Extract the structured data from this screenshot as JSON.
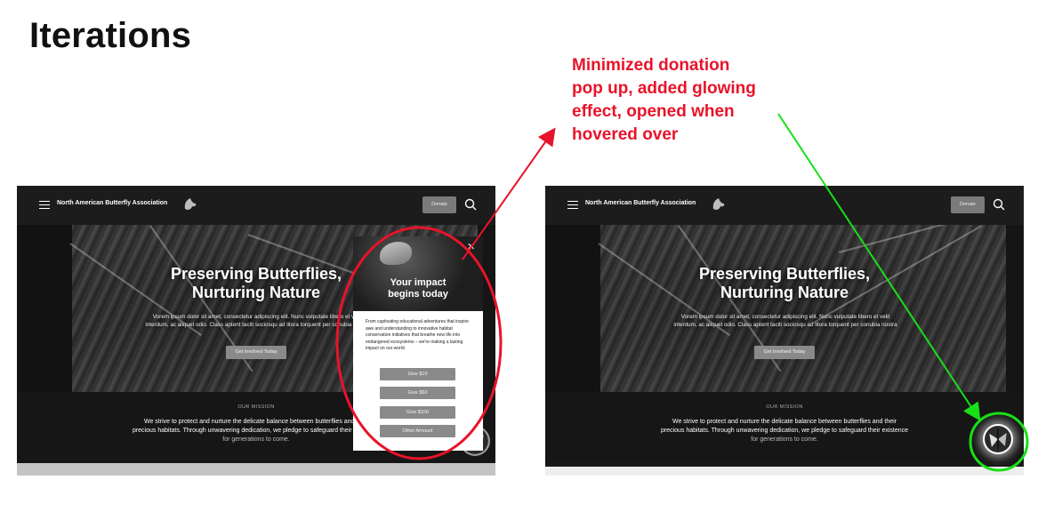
{
  "slide": {
    "title": "Iterations",
    "annotation": {
      "lines": [
        "Minimized donation",
        "pop up, added glowing",
        "effect, opened when",
        "hovered over"
      ],
      "color": "#e8132a"
    }
  },
  "site": {
    "brand": "North American Butterfly Association",
    "donate_label": "Donate",
    "hero": {
      "title_line1": "Preserving Butterflies,",
      "title_line2": "Nurturing Nature",
      "body_line1": "Vorem ipsum dolor sit amet, consectetur adipiscing elit. Nunc vulputate libero et velit",
      "body_line2": "interdum, ac aliquet odio. Class aptent taciti sociosqu ad litora torquent per conubia nostra",
      "cta": "Get Involved Today"
    },
    "mission": {
      "label": "OUR MISSION",
      "line1": "We strive to protect and nurture the delicate balance between butterflies and their",
      "line2": "precious habitats. Through unwavering dedication, we pledge to safeguard their existence",
      "line3": "for generations to come."
    }
  },
  "popup": {
    "title_line1": "Your impact",
    "title_line2": "begins today",
    "close": "✕",
    "body": "From captivating educational adventures that inspire awe and understanding to innovative habitat conservation initiatives that breathe new life into endangered ecosystems – we're making a lasting impact on our world.",
    "buttons": [
      "Give $10",
      "Give $50",
      "Give $100",
      "Other Amount"
    ]
  },
  "icons": {
    "menu": "hamburger-icon",
    "logo": "butterfly-logo-icon",
    "search": "search-icon",
    "fab": "butterfly-fab-icon",
    "close": "close-icon"
  },
  "colors": {
    "red_annotation": "#e8132a",
    "green_annotation": "#18e018",
    "site_dark": "#1a1a1a",
    "button_gray": "#8a8a8a"
  }
}
